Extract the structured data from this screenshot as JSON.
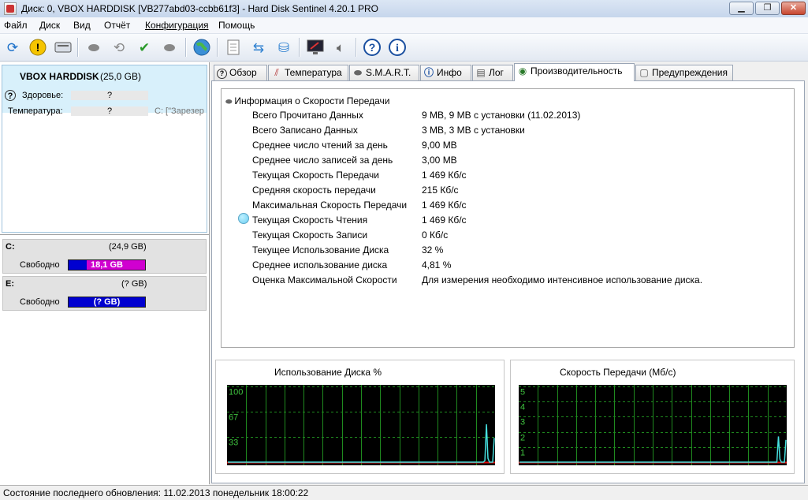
{
  "window": {
    "title": "Диск: 0, VBOX HARDDISK [VB277abd03-ccbb61f3]  -  Hard Disk Sentinel 4.20.1 PRO",
    "buttons": {
      "minimize": "▁",
      "maximize": "❐",
      "close": "✕"
    }
  },
  "menu": [
    "Файл",
    "Диск",
    "Вид",
    "Отчёт",
    "Конфигурация",
    "Помощь"
  ],
  "toolbar": {
    "icons": [
      "refresh-icon",
      "warning-icon",
      "drive-icon",
      "usb-drive-icon",
      "drive-refresh-icon",
      "drive-check-icon",
      "usb-settings-icon",
      "globe-icon",
      "report-icon",
      "sync-icon",
      "network-icon",
      "monitor-icon",
      "speaker-icon",
      "help-icon",
      "info-icon"
    ]
  },
  "disk": {
    "name": "VBOX HARDDISK",
    "size": "(25,0 GB)",
    "health_label": "Здоровье:",
    "health_value": "?",
    "temp_label": "Температура:",
    "temp_value": "?",
    "partition_note": "C: [\"Зарезер"
  },
  "volumes": [
    {
      "letter": "C:",
      "size": "(24,9 GB)",
      "free_label": "Свободно",
      "free_value": "18,1 GB",
      "color": "#d000d0"
    },
    {
      "letter": "E:",
      "size": "(? GB)",
      "free_label": "Свободно",
      "free_value": "(? GB)",
      "color": "#0000d0"
    }
  ],
  "tabs": [
    {
      "label": "Обзор",
      "icon": "help-icon",
      "active": false
    },
    {
      "label": "Температура",
      "icon": "thermometer-icon",
      "active": false
    },
    {
      "label": "S.M.A.R.T.",
      "icon": "smart-icon",
      "active": false
    },
    {
      "label": "Инфо",
      "icon": "info-icon",
      "active": false
    },
    {
      "label": "Лог",
      "icon": "log-icon",
      "active": false
    },
    {
      "label": "Производительность",
      "icon": "gauge-icon",
      "active": true
    },
    {
      "label": "Предупреждения",
      "icon": "alerts-icon",
      "active": false
    }
  ],
  "performance": {
    "section_title": "Информация о Скорости Передачи",
    "rows": [
      {
        "label": "Всего Прочитано Данных",
        "value": "9 MB,  9 MB с установки  (11.02.2013)"
      },
      {
        "label": "Всего Записано Данных",
        "value": "3 MB,  3 MB с установки"
      },
      {
        "label": "Среднее число чтений за день",
        "value": "9,00 MB"
      },
      {
        "label": "Среднее число записей за день",
        "value": "3,00 MB"
      },
      {
        "label": "Текущая Скорость Передачи",
        "value": "1 469 Кб/с"
      },
      {
        "label": "Средняя скорость передачи",
        "value": "215 Кб/с"
      },
      {
        "label": "Максимальная Скорость Передачи",
        "value": "1 469 Кб/с"
      },
      {
        "label": "Текущая Скорость Чтения",
        "value": "1 469 Кб/с"
      },
      {
        "label": "Текущая Скорость Записи",
        "value": "0 Кб/с"
      },
      {
        "label": "Текущее Использование Диска",
        "value": "32 %"
      },
      {
        "label": "Среднее использование диска",
        "value": "4,81 %"
      },
      {
        "label": "Оценка Максимальной Скорости",
        "value": "Для измерения необходимо интенсивное использование диска."
      }
    ]
  },
  "charts": {
    "usage_title": "Использование Диска %",
    "speed_title": "Скорость Передачи (Мб/с)"
  },
  "chart_data": [
    {
      "type": "line",
      "title": "Использование Диска %",
      "ylim": [
        0,
        100
      ],
      "yticks": [
        "100",
        "67",
        "33"
      ],
      "series": [
        {
          "values": [
            0,
            0,
            0,
            0,
            0,
            0,
            0,
            0,
            0,
            0,
            0,
            0,
            0,
            0,
            0,
            0,
            0,
            0,
            0,
            0,
            0,
            0,
            0,
            0,
            0,
            0,
            0,
            0,
            0,
            0,
            0,
            0,
            0,
            0,
            0,
            0,
            0,
            0,
            0,
            0,
            0,
            0,
            0,
            0,
            0,
            0,
            0,
            0,
            0,
            0,
            0,
            0,
            0,
            0,
            0,
            0,
            0,
            0,
            0,
            0,
            0,
            0,
            0,
            0,
            0,
            0,
            0,
            0,
            0,
            0,
            0,
            0,
            0,
            0,
            0,
            0,
            0,
            0,
            0,
            0,
            0,
            0,
            0,
            0,
            0,
            0,
            0,
            0,
            0,
            0,
            0,
            0,
            0,
            0,
            0,
            0,
            0,
            0,
            0,
            0,
            0,
            0,
            0,
            0,
            0,
            0,
            0,
            0,
            0,
            0,
            0,
            0,
            0,
            0,
            0,
            0,
            0,
            0,
            0,
            0,
            0,
            0,
            0,
            0,
            0,
            0,
            0,
            0,
            0,
            0,
            0,
            0,
            0,
            0,
            0,
            0,
            0,
            0,
            0,
            0,
            0,
            0,
            0,
            0,
            0,
            0,
            0,
            0,
            0,
            0,
            0,
            0,
            0,
            0,
            0,
            0,
            0,
            0,
            0,
            0,
            0,
            0,
            0,
            0,
            2,
            50,
            5,
            0,
            0,
            0,
            32
          ]
        }
      ]
    },
    {
      "type": "line",
      "title": "Скорость Передачи (Мб/с)",
      "ylim": [
        0,
        5
      ],
      "yticks": [
        "5",
        "4",
        "3",
        "2",
        "1"
      ],
      "series": [
        {
          "values": [
            0,
            0,
            0,
            0,
            0,
            0,
            0,
            0,
            0,
            0,
            0,
            0,
            0,
            0,
            0,
            0,
            0,
            0,
            0,
            0,
            0,
            0,
            0,
            0,
            0,
            0,
            0,
            0,
            0,
            0,
            0,
            0,
            0,
            0,
            0,
            0,
            0,
            0,
            0,
            0,
            0,
            0,
            0,
            0,
            0,
            0,
            0,
            0,
            0,
            0,
            0,
            0,
            0,
            0,
            0,
            0,
            0,
            0,
            0,
            0,
            0,
            0,
            0,
            0,
            0,
            0,
            0,
            0,
            0,
            0,
            0,
            0,
            0,
            0,
            0,
            0,
            0,
            0,
            0,
            0,
            0,
            0,
            0,
            0,
            0,
            0,
            0,
            0,
            0,
            0,
            0,
            0,
            0,
            0,
            0,
            0,
            0,
            0,
            0,
            0,
            0,
            0,
            0,
            0,
            0,
            0,
            0,
            0,
            0,
            0,
            0,
            0,
            0,
            0,
            0,
            0,
            0,
            0,
            0,
            0,
            0,
            0,
            0,
            0,
            0,
            0,
            0,
            0,
            0,
            0,
            0,
            0,
            0,
            0,
            0,
            0,
            0,
            0,
            0,
            0,
            0,
            0,
            0,
            0,
            0,
            0,
            0,
            0,
            0,
            0,
            0,
            0,
            0,
            0,
            0,
            0,
            0,
            0,
            0,
            0,
            0,
            0,
            0,
            0,
            0,
            0,
            0,
            0,
            0,
            0,
            0,
            0,
            1.7,
            0.2,
            0,
            0,
            0,
            1.47
          ]
        }
      ]
    }
  ],
  "status": {
    "text": "Состояние последнего обновления: 11.02.2013 понедельник 18:00:22"
  }
}
